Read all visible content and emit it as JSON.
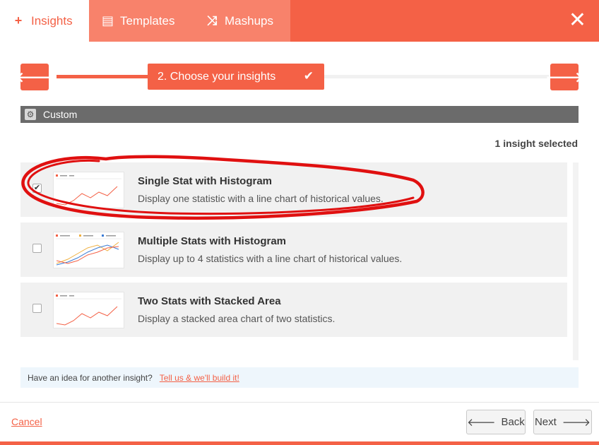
{
  "tabs": [
    {
      "icon": "plus-icon",
      "glyph": "+",
      "label": "Insights",
      "active": true
    },
    {
      "icon": "template-icon",
      "glyph": "▤",
      "label": "Templates",
      "active": false
    },
    {
      "icon": "shuffle-icon",
      "glyph": "⤨",
      "label": "Mashups",
      "active": false
    }
  ],
  "close_glyph": "✕",
  "wizard": {
    "prev_glyph": "🡐",
    "next_glyph": "🡒",
    "step_label": "2. Choose your insights",
    "step_check": "✔"
  },
  "category": {
    "icon": "gears-icon",
    "label": "Custom"
  },
  "selected_count": "1 insight selected",
  "insights": [
    {
      "title": "Single Stat with Histogram",
      "desc": "Display one statistic with a line chart of historical values.",
      "checked": true,
      "check_glyph": "✔"
    },
    {
      "title": "Multiple Stats with Histogram",
      "desc": "Display up to 4 statistics with a line chart of historical values.",
      "checked": false,
      "check_glyph": ""
    },
    {
      "title": "Two Stats with Stacked Area",
      "desc": "Display a stacked area chart of two statistics.",
      "checked": false,
      "check_glyph": ""
    }
  ],
  "idea": {
    "text": "Have an idea for another insight?",
    "link": "Tell us & we'll build it!"
  },
  "footer": {
    "cancel": "Cancel",
    "back": "Back",
    "back_glyph": "🡐",
    "next": "Next",
    "next_glyph": "🡒"
  },
  "colors": {
    "accent": "#f46146",
    "tab_inactive": "#f8826b",
    "annotation": "#e01010"
  }
}
